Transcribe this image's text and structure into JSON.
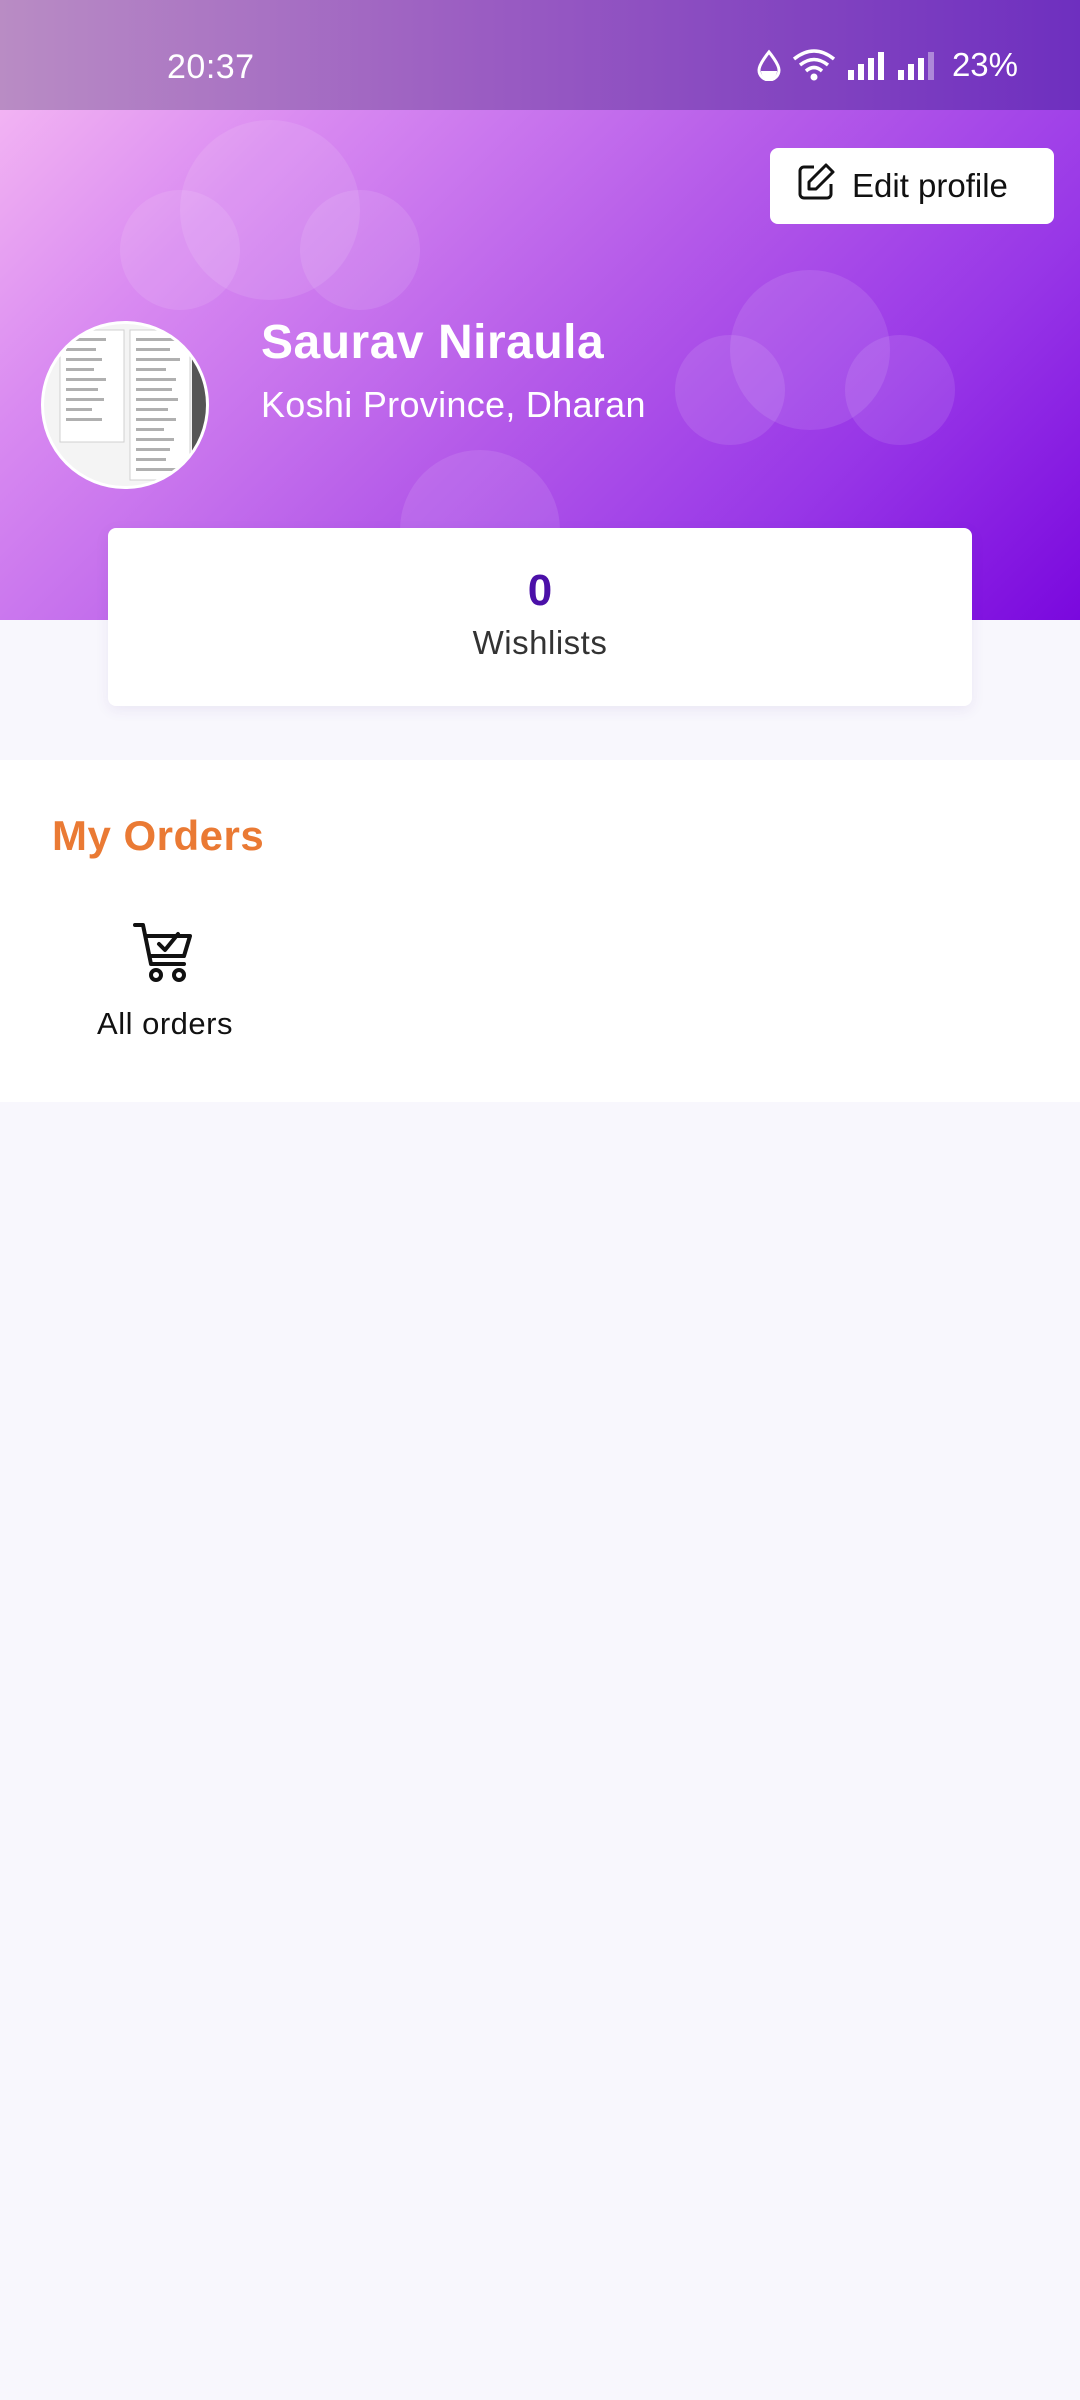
{
  "status_bar": {
    "time": "20:37",
    "battery": "23%",
    "icons": [
      "data-saver-icon",
      "wifi-icon",
      "signal-icon",
      "signal-icon-2"
    ]
  },
  "header": {
    "edit_button_label": "Edit profile",
    "edit_icon": "edit-icon",
    "user_name": "Saurav Niraula",
    "user_location": "Koshi Province, Dharan",
    "colors": {
      "gradient_start": "#f2b3f3",
      "gradient_end": "#7a08de"
    }
  },
  "stats": {
    "wishlist_count": "0",
    "wishlist_label": "Wishlists"
  },
  "orders": {
    "title": "My Orders",
    "items": [
      {
        "label": "All orders",
        "icon": "cart-check-icon"
      }
    ],
    "colors": {
      "title": "#ea7a34"
    }
  }
}
